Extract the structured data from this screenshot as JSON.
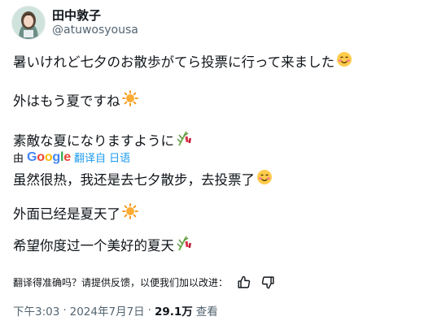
{
  "author": {
    "display_name": "田中敦子",
    "handle": "@atuwosyousa"
  },
  "original_text": {
    "line1": "暑いけれど七夕のお散歩がてら投票に行って来ました",
    "line2": "外はもう夏ですね",
    "line3": "素敵な夏になりますように"
  },
  "translation_bar": {
    "prefix": "由",
    "google_letters": [
      "G",
      "o",
      "o",
      "g",
      "l",
      "e"
    ],
    "google_colors": [
      "#4285F4",
      "#EA4335",
      "#FBBC05",
      "#4285F4",
      "#34A853",
      "#EA4335"
    ],
    "link_text": "翻译自 日语"
  },
  "translated_text": {
    "line1": "虽然很热，我还是去七夕散步，去投票了",
    "line2": "外面已经是夏天了",
    "line3": "希望你度过一个美好的夏天"
  },
  "feedback": {
    "question": "翻译得准确吗？请提供反馈，以便我们加以改进："
  },
  "meta": {
    "time": "下午3:03",
    "separator": "·",
    "date": "2024年7月7日",
    "views_count": "29.1万",
    "views_label": "查看"
  },
  "emoji_names": [
    "smiling-face-with-blush-icon",
    "sun-icon",
    "tanabata-tree-icon"
  ],
  "colors": {
    "text": "#0f1419",
    "secondary": "#536471",
    "link": "#1d9bf0"
  }
}
